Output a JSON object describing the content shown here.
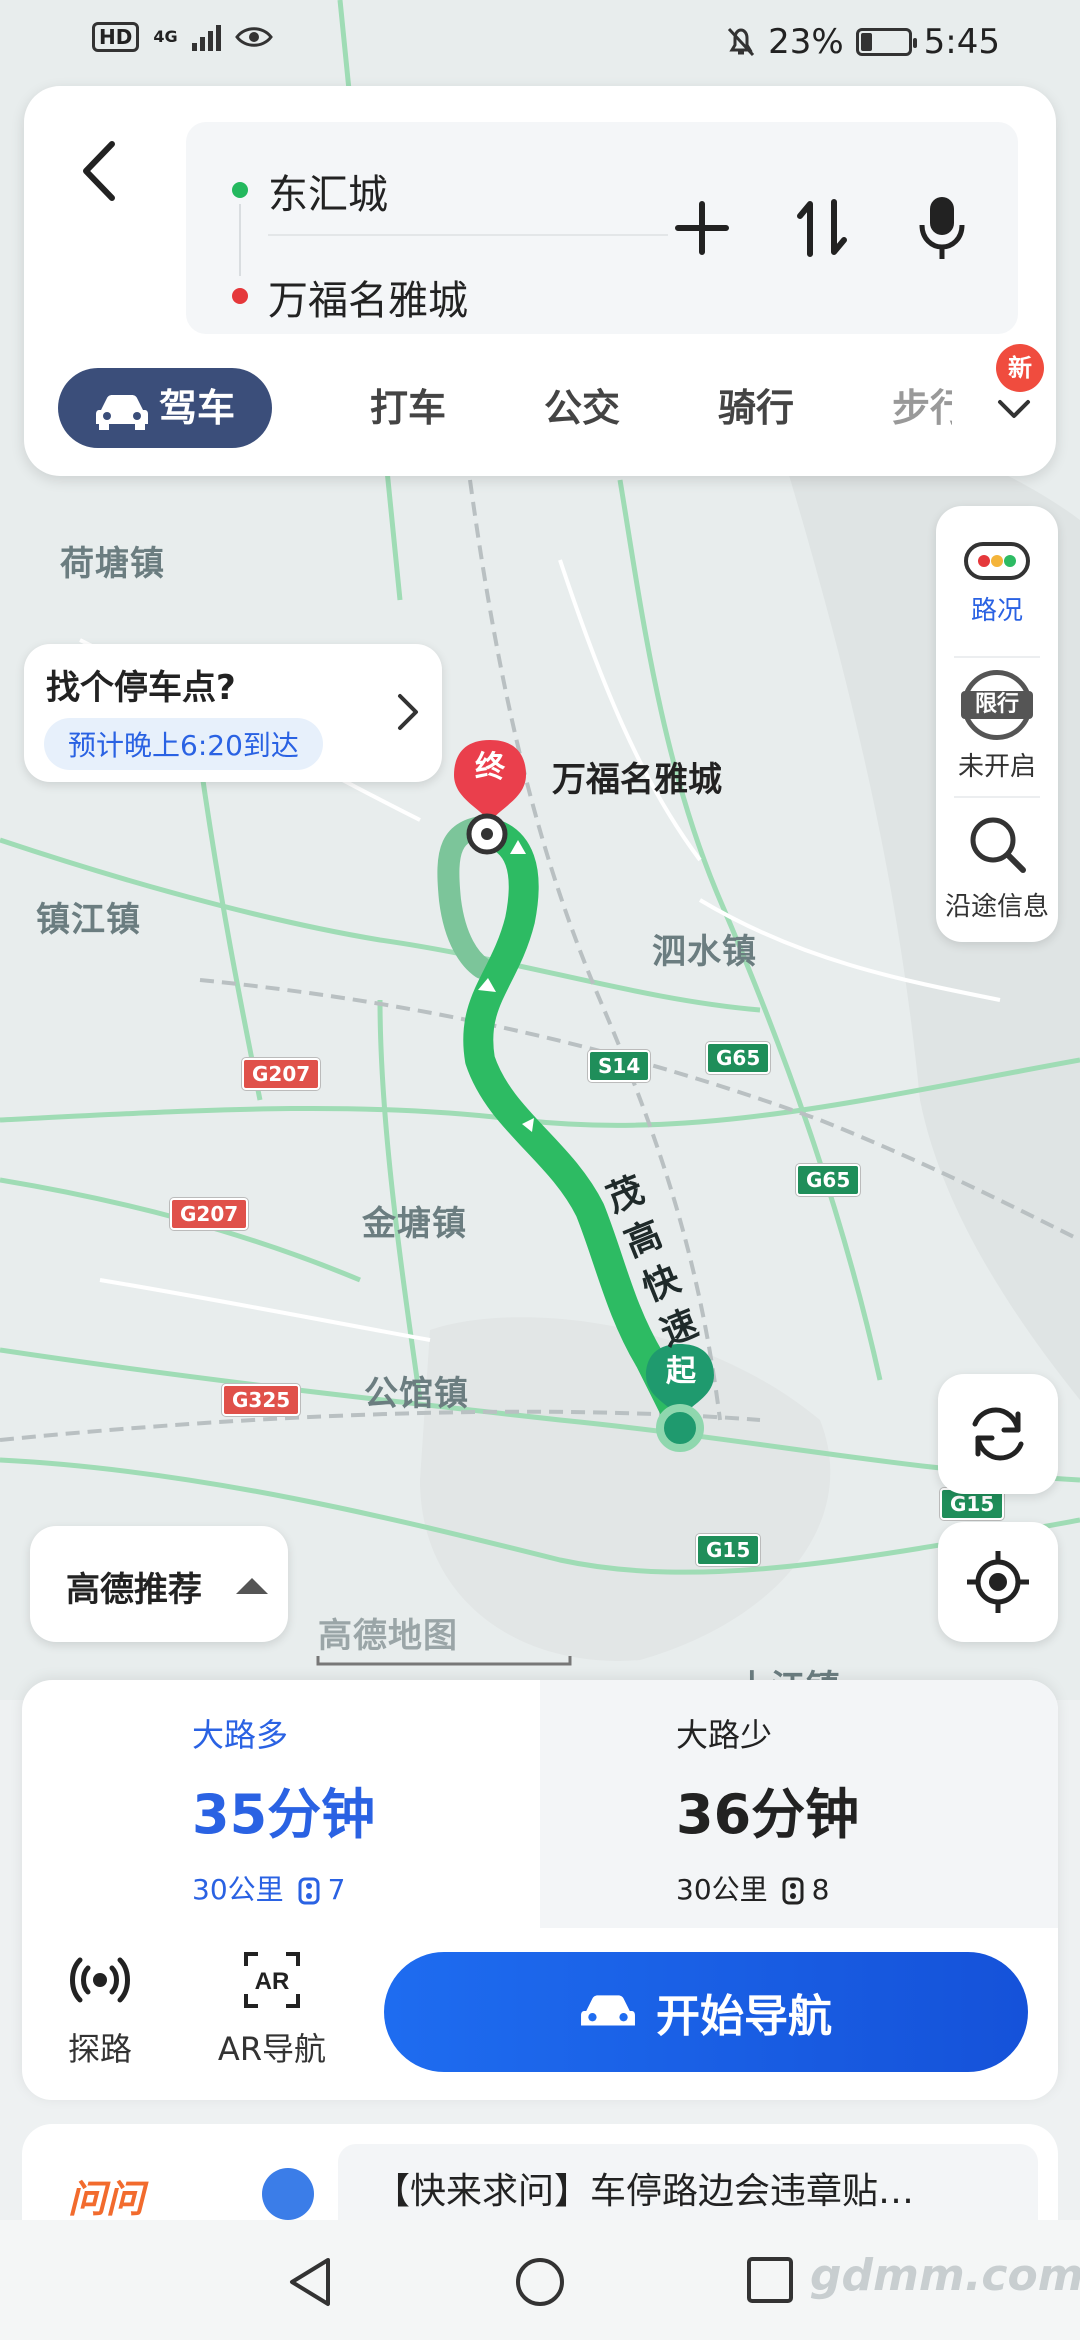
{
  "status_bar": {
    "network": "4G",
    "battery": "23%",
    "battery_level": 0.23,
    "time": "5:45"
  },
  "route": {
    "from": "东汇城",
    "to": "万福名雅城"
  },
  "tabs": [
    {
      "label": "驾车"
    },
    {
      "label": "打车"
    },
    {
      "label": "公交"
    },
    {
      "label": "骑行"
    },
    {
      "label": "步行"
    }
  ],
  "new_badge": "新",
  "side_panel": {
    "traffic": "路况",
    "restriction_badge": "限行",
    "restriction": "未开启",
    "along": "沿途信息"
  },
  "parking": {
    "title": "找个停车点?",
    "eta": "预计晚上6:20到达"
  },
  "map": {
    "labels": {
      "hetang": "荷塘镇",
      "zhenjiang": "镇江镇",
      "sishui": "泗水镇",
      "jintang": "金塘镇",
      "gongguan": "公馆镇",
      "shangjiang": "上江镇"
    },
    "road_name": "茂高快速",
    "end_marker": "终",
    "start_marker": "起",
    "shields": {
      "g207a": "G207",
      "g207b": "G207",
      "s14": "S14",
      "g65a": "G65",
      "g65b": "G65",
      "g325": "G325",
      "g15a": "G15",
      "g15b": "G15"
    },
    "watermark": "高德地图"
  },
  "recommend": "高德推荐",
  "options": [
    {
      "tag": "大路多",
      "time": "35分钟",
      "distance": "30公里",
      "lights": "7"
    },
    {
      "tag": "大路少",
      "time": "36分钟",
      "distance": "30公里",
      "lights": "8"
    }
  ],
  "actions": {
    "explore": "探路",
    "ar_nav": "AR导航",
    "start": "开始导航"
  },
  "ask": {
    "logo": "问问",
    "text": "【快来求问】车停路边会违章贴…"
  },
  "footer_watermark": "gdmm.com",
  "colors": {
    "accent": "#2a62e3",
    "route_green": "#2dbb63",
    "active_tab": "#3b4e7a"
  }
}
